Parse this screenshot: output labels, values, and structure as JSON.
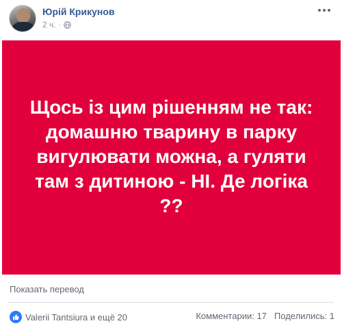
{
  "post": {
    "author_name": "Юрій Крикунов",
    "time": "2 ч.",
    "separator": "·",
    "banner_text": "Щось із цим рішенням не так: домашню тварину в парку вигулювати можна, а гуляти там з дитиною - НІ. Де логіка ??",
    "banner_color": "#e2003c",
    "translate_label": "Показать перевод"
  },
  "footer": {
    "reactions_text": "Valerii Tantsiura и ещё 20",
    "comments_text": "Комментарии: 17",
    "shares_text": "Поделились: 1"
  },
  "icons": {
    "privacy": "globe-icon",
    "reaction": "like-icon",
    "menu": "more-options-icon"
  },
  "colors": {
    "link": "#385898",
    "secondary_text": "#606770",
    "like_blue": "#2e7bf6"
  }
}
